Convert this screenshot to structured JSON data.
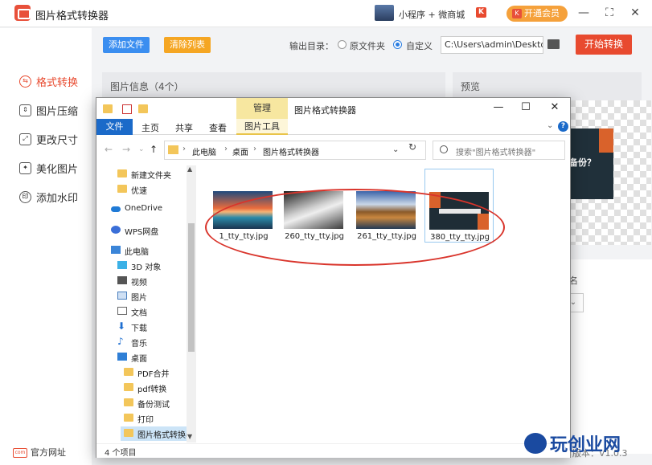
{
  "app": {
    "title": "图片格式转换器",
    "mini_program": "小程序 + 微商城",
    "k_badge": "K",
    "vip_label": "开通会员",
    "controls": {
      "min": "—",
      "max": "⛶",
      "close": "✕"
    }
  },
  "sidebar": {
    "items": [
      {
        "label": "格式转换",
        "icon": "format-convert-icon",
        "active": true
      },
      {
        "label": "图片压缩",
        "icon": "compress-icon"
      },
      {
        "label": "更改尺寸",
        "icon": "resize-icon"
      },
      {
        "label": "美化图片",
        "icon": "beautify-icon"
      },
      {
        "label": "添加水印",
        "icon": "watermark-icon"
      }
    ],
    "site_link": "官方网址"
  },
  "toolbar": {
    "add_file": "添加文件",
    "clear_list": "清除列表",
    "output_label": "输出目录：",
    "radio_original": "原文件夹",
    "radio_custom": "自定义",
    "path_value": "C:\\Users\\admin\\Deskto",
    "start": "开始转换"
  },
  "panels": {
    "image_info": "图片信息（4个）",
    "preview": "预览",
    "preview_text": "备份？",
    "right_label": "名",
    "version": "版本：V1.0.3"
  },
  "explorer": {
    "manage_tab": "管理",
    "title": "图片格式转换器",
    "ribbon": {
      "file": "文件",
      "home": "主页",
      "share": "共享",
      "view": "查看",
      "picture_tools": "图片工具"
    },
    "controls": {
      "min": "—",
      "max": "☐",
      "close": "✕"
    },
    "breadcrumb": [
      "此电脑",
      "桌面",
      "图片格式转换器"
    ],
    "search_placeholder": "搜索\"图片格式转换器\"",
    "nav": [
      "新建文件夹",
      "优速",
      "OneDrive",
      "WPS网盘",
      "此电脑",
      "3D 对象",
      "视频",
      "图片",
      "文档",
      "下载",
      "音乐",
      "桌面",
      "PDF合并",
      "pdf转换",
      "备份测试",
      "打印",
      "图片格式转换器"
    ],
    "files": [
      {
        "name": "1_tty_tty.jpg"
      },
      {
        "name": "260_tty_tty.jpg"
      },
      {
        "name": "261_tty_tty.jpg"
      },
      {
        "name": "380_tty_tty.jpg",
        "selected": true
      }
    ],
    "status": "4 个项目"
  },
  "watermark": "玩创业网",
  "colors": {
    "accent": "#e84a2f",
    "blue": "#3b8ef0",
    "orange": "#f5a623",
    "explorer_blue": "#1b6ac9"
  }
}
